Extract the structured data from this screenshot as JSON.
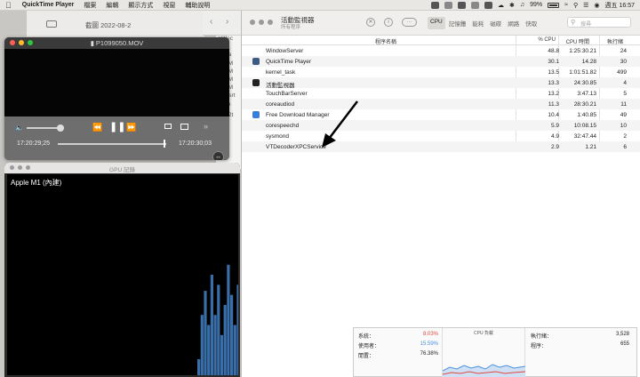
{
  "menubar": {
    "apple": "",
    "items": [
      "QuickTime Player",
      "檔案",
      "編輯",
      "顯示方式",
      "視窗",
      "輔助說明"
    ],
    "battery": "99%",
    "clock": "週五 16:57"
  },
  "bg_window": {
    "title": "截圖 2022-08-2",
    "files": [
      "ntitlec",
      "64計",
      "ltRea",
      "3V1M",
      "3V1M",
      "3V1M",
      "3V1M",
      "nke.srt",
      "mpIn",
      "型 72t",
      "整",
      "ong",
      "ong",
      "ong"
    ]
  },
  "quicktime": {
    "title": "P1099050.MOV",
    "time_current": "17:20:29;25",
    "time_end": "17:20:30;03",
    "volume": 0.9,
    "progress": 0.98
  },
  "gpu_window": {
    "title": "GPU 記錄",
    "gpu_name": "Apple M1 (內建)",
    "bars": [
      0.08,
      0.3,
      0.42,
      0.25,
      0.5,
      0.3,
      0.45,
      0.2,
      0.35,
      0.55,
      0.4,
      0.25,
      0.45,
      0.3,
      0.5,
      0.35,
      0.55,
      0.3,
      0.48,
      0.22,
      0.38,
      0.32
    ]
  },
  "activity_monitor": {
    "title": "活動監視器",
    "subtitle": "所有程序",
    "tabs": [
      "CPU",
      "記憶體",
      "能耗",
      "磁碟",
      "網路",
      "快取"
    ],
    "active_tab": "CPU",
    "search_placeholder": "搜尋",
    "columns": [
      "程序名稱",
      "% CPU",
      "CPU 時間",
      "執行緒"
    ],
    "rows": [
      {
        "name": "WindowServer",
        "cpu": "48.8",
        "time": "1:25:30.21",
        "threads": "24",
        "icon": ""
      },
      {
        "name": "QuickTime Player",
        "cpu": "30.1",
        "time": "14.28",
        "threads": "30",
        "icon": "qt"
      },
      {
        "name": "kernel_task",
        "cpu": "13.5",
        "time": "1:01:51.82",
        "threads": "499",
        "icon": ""
      },
      {
        "name": "活動監視器",
        "cpu": "13.3",
        "time": "24:30.85",
        "threads": "4",
        "icon": "am"
      },
      {
        "name": "TouchBarServer",
        "cpu": "13.2",
        "time": "3:47.13",
        "threads": "5",
        "icon": ""
      },
      {
        "name": "coreaudiod",
        "cpu": "11.3",
        "time": "28:30.21",
        "threads": "11",
        "icon": ""
      },
      {
        "name": "Free Download Manager",
        "cpu": "10.4",
        "time": "1:40.85",
        "threads": "49",
        "icon": "fdm"
      },
      {
        "name": "corespeechd",
        "cpu": "5.9",
        "time": "10:08.15",
        "threads": "10",
        "icon": ""
      },
      {
        "name": "sysmond",
        "cpu": "4.9",
        "time": "32:47.44",
        "threads": "2",
        "icon": ""
      },
      {
        "name": "VTDecoderXPCService",
        "cpu": "2.9",
        "time": "1.21",
        "threads": "6",
        "icon": ""
      }
    ],
    "footer": {
      "system_label": "系統：",
      "system_value": "8.03%",
      "user_label": "使用者：",
      "user_value": "15.59%",
      "idle_label": "閒置：",
      "idle_value": "76.38%",
      "load_caption": "CPU 負載",
      "threads_label": "執行緒：",
      "threads_value": "3,528",
      "procs_label": "程序：",
      "procs_value": "655",
      "colors": {
        "system": "#e0483e",
        "user": "#4a8fe0"
      }
    }
  }
}
